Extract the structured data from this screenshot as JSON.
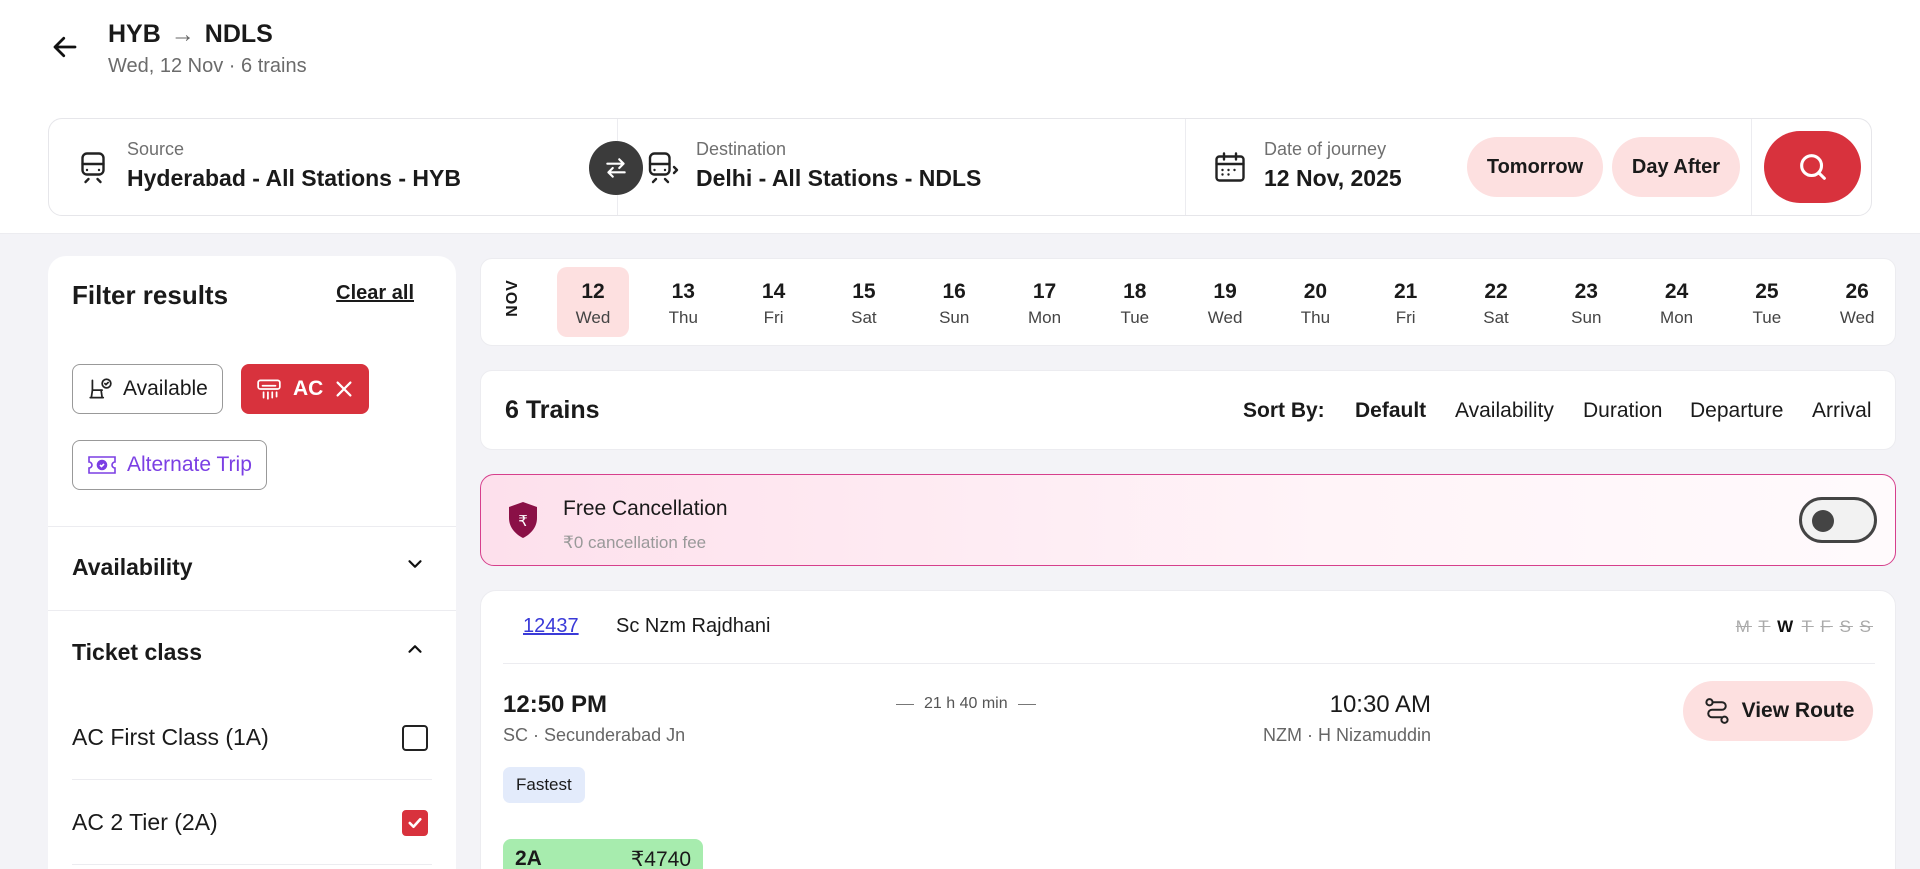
{
  "header": {
    "from_code": "HYB",
    "to_code": "NDLS",
    "subtitle": "Wed, 12 Nov · 6 trains"
  },
  "search": {
    "source_label": "Source",
    "source_value": "Hyderabad - All Stations - HYB",
    "destination_label": "Destination",
    "destination_value": "Delhi - All Stations - NDLS",
    "date_label": "Date of journey",
    "date_value": "12 Nov, 2025",
    "tomorrow_label": "Tomorrow",
    "day_after_label": "Day After"
  },
  "filters": {
    "title": "Filter results",
    "clear_label": "Clear all",
    "chips": {
      "available": "Available",
      "ac": "AC",
      "alternate": "Alternate Trip"
    },
    "sections": {
      "availability": "Availability",
      "ticket_class": "Ticket class"
    },
    "classes": [
      {
        "label": "AC First Class (1A)",
        "checked": false
      },
      {
        "label": "AC 2 Tier (2A)",
        "checked": true
      }
    ]
  },
  "date_strip": {
    "month": "NOV",
    "days": [
      {
        "num": "12",
        "wd": "Wed",
        "selected": true
      },
      {
        "num": "13",
        "wd": "Thu"
      },
      {
        "num": "14",
        "wd": "Fri"
      },
      {
        "num": "15",
        "wd": "Sat"
      },
      {
        "num": "16",
        "wd": "Sun"
      },
      {
        "num": "17",
        "wd": "Mon"
      },
      {
        "num": "18",
        "wd": "Tue"
      },
      {
        "num": "19",
        "wd": "Wed"
      },
      {
        "num": "20",
        "wd": "Thu"
      },
      {
        "num": "21",
        "wd": "Fri"
      },
      {
        "num": "22",
        "wd": "Sat"
      },
      {
        "num": "23",
        "wd": "Sun"
      },
      {
        "num": "24",
        "wd": "Mon"
      },
      {
        "num": "25",
        "wd": "Tue"
      },
      {
        "num": "26",
        "wd": "Wed"
      }
    ]
  },
  "sort": {
    "count_label": "6 Trains",
    "sort_by_label": "Sort By:",
    "options": [
      "Default",
      "Availability",
      "Duration",
      "Departure",
      "Arrival"
    ],
    "active": "Default"
  },
  "free_cancellation": {
    "title": "Free Cancellation",
    "subtitle": "₹0 cancellation fee",
    "enabled": false
  },
  "train": {
    "number": "12437",
    "name": "Sc Nzm Rajdhani",
    "run_days": [
      "M",
      "T",
      "W",
      "T",
      "F",
      "S",
      "S"
    ],
    "run_days_active_index": 2,
    "departure_time": "12:50 PM",
    "departure_station": "SC · Secunderabad Jn",
    "duration": "21 h 40 min",
    "arrival_time": "10:30 AM",
    "arrival_station": "NZM · H Nizamuddin",
    "view_route_label": "View Route",
    "tag": "Fastest",
    "fare": {
      "class": "2A",
      "price": "₹4740"
    }
  },
  "colors": {
    "accent_red": "#d8323d",
    "pill_pink": "#fde0e0",
    "purple": "#7b3fe4",
    "fare_green": "#a7ecae",
    "tag_blue": "#e3ebfb"
  }
}
